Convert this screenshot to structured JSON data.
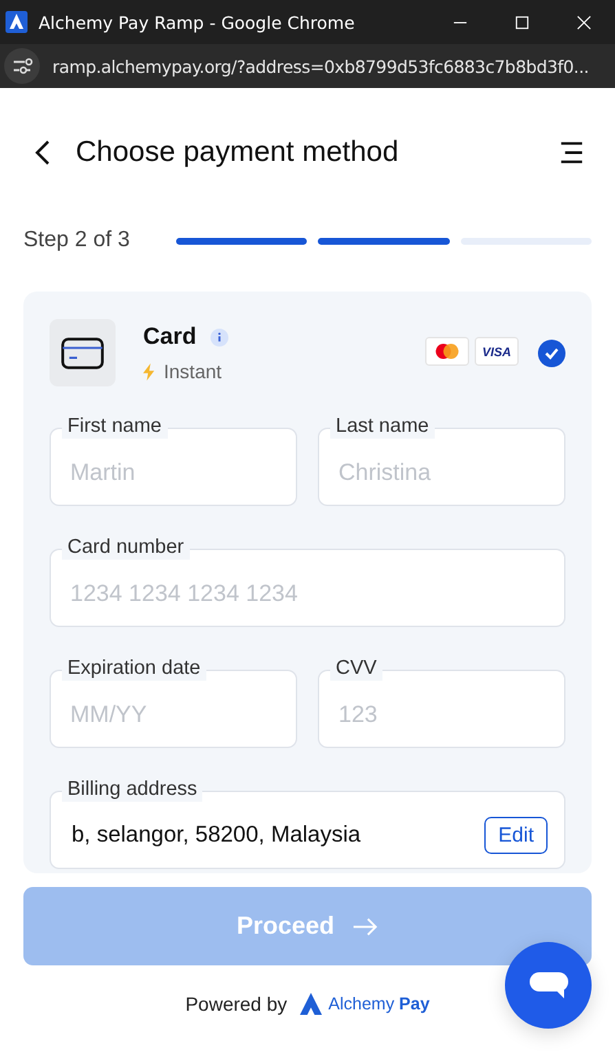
{
  "window": {
    "title": "Alchemy Pay Ramp - Google Chrome",
    "url": "ramp.alchemypay.org/?address=0xb8799d53fc6883c7b8bd3f0..."
  },
  "header": {
    "title": "Choose payment method"
  },
  "step": {
    "label": "Step 2 of 3",
    "segments": [
      {
        "completed": true
      },
      {
        "completed": true
      },
      {
        "completed": false
      }
    ]
  },
  "method": {
    "name": "Card",
    "speed": "Instant",
    "brands": [
      {
        "kind": "mastercard"
      },
      {
        "kind": "visa",
        "label": "VISA"
      }
    ],
    "selected": true
  },
  "field_rows": [
    [
      {
        "label": "First name",
        "placeholder": "Martin"
      },
      {
        "label": "Last name",
        "placeholder": "Christina"
      }
    ],
    [
      {
        "label": "Card number",
        "placeholder": "1234 1234 1234 1234"
      }
    ],
    [
      {
        "label": "Expiration date",
        "placeholder": "MM/YY"
      },
      {
        "label": "CVV",
        "placeholder": "123"
      }
    ],
    [
      {
        "label": "Billing address",
        "value": "b, selangor, 58200, Malaysia",
        "action": "Edit"
      }
    ]
  ],
  "proceed": {
    "label": "Proceed",
    "disabled": true
  },
  "footer": {
    "text": "Powered by",
    "brand": "Alchemy",
    "brand_accent": "Pay"
  }
}
